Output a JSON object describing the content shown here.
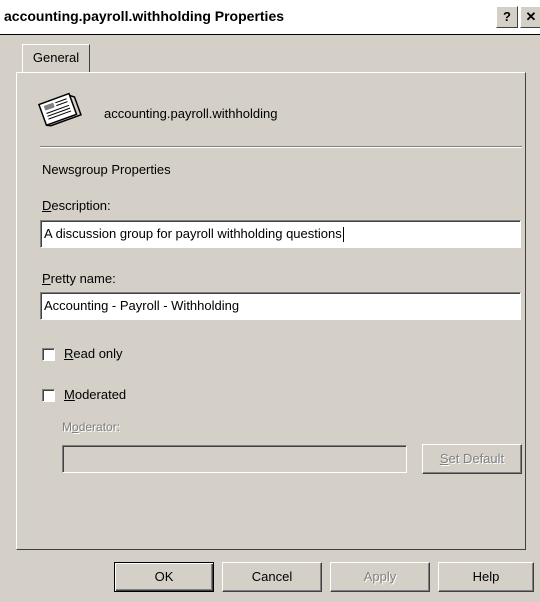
{
  "window": {
    "title": "accounting.payroll.withholding Properties",
    "help_glyph": "?",
    "close_glyph": "✕"
  },
  "tabs": [
    {
      "label": "General"
    }
  ],
  "header": {
    "icon": "newsgroup-icon",
    "name": "accounting.payroll.withholding"
  },
  "section_title": "Newsgroup Properties",
  "description": {
    "label_mnemonic": "D",
    "label_rest": "escription:",
    "value": "A discussion group for payroll withholding questions"
  },
  "pretty_name": {
    "label_mnemonic": "P",
    "label_rest": "retty name:",
    "value": "Accounting - Payroll - Withholding"
  },
  "read_only": {
    "label_mnemonic": "R",
    "label_rest": "ead only",
    "checked": false
  },
  "moderated": {
    "label_mnemonic": "M",
    "label_rest": "oderated",
    "checked": false
  },
  "moderator": {
    "label_pre": "M",
    "label_mnemonic": "o",
    "label_rest": "derator:",
    "value": "",
    "enabled": false
  },
  "set_default": {
    "label_mnemonic": "S",
    "label_rest": "et Default",
    "enabled": false
  },
  "footer": {
    "ok": "OK",
    "cancel": "Cancel",
    "apply": "Apply",
    "help": "Help"
  }
}
